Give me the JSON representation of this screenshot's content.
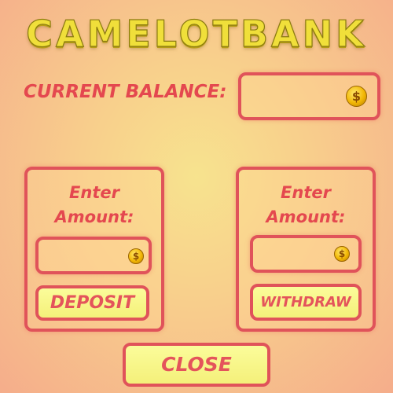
{
  "title": "CAMELOTBANK",
  "balance": {
    "label": "CURRENT BALANCE:",
    "value": "",
    "coin_symbol": "$"
  },
  "deposit_panel": {
    "prompt_line1": "Enter",
    "prompt_line2": "Amount:",
    "input_value": "",
    "coin_symbol": "$",
    "button_label": "DEPOSIT"
  },
  "withdraw_panel": {
    "prompt_line1": "Enter",
    "prompt_line2": "Amount:",
    "input_value": "",
    "coin_symbol": "$",
    "button_label": "WITHDRAW"
  },
  "close_button": {
    "label": "CLOSE"
  },
  "colors": {
    "title_gold": "#f0df3a",
    "accent_red": "#e0535a",
    "button_fill": "#f8f68a"
  },
  "icons": [
    "coin-icon"
  ]
}
